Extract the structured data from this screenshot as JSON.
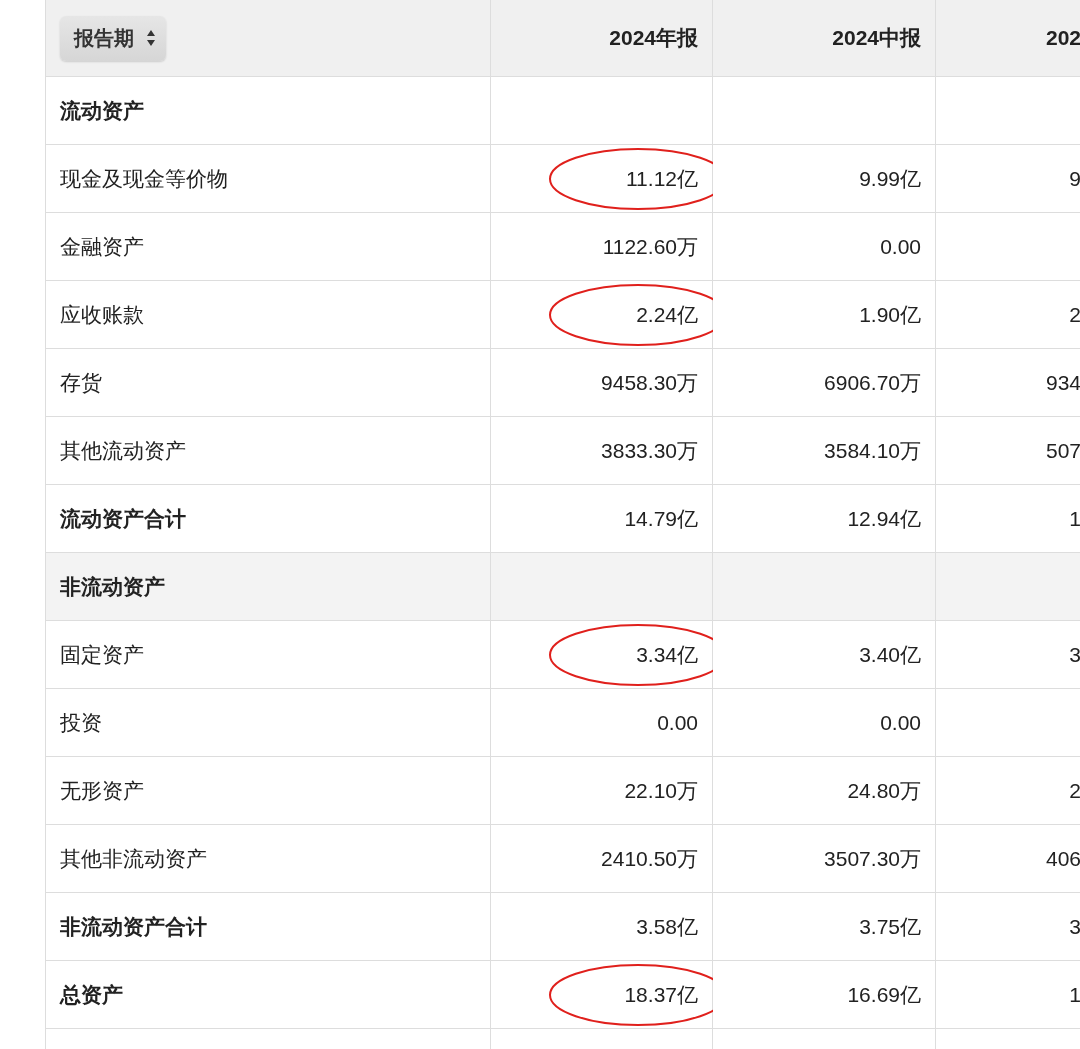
{
  "table": {
    "sort_button": {
      "label": "报告期"
    },
    "columns": [
      "2024年报",
      "2024中报",
      "202"
    ],
    "rows": [
      {
        "kind": "section",
        "label": "流动资产",
        "shaded": false,
        "circled": false
      },
      {
        "kind": "item",
        "label": "现金及现金等价物",
        "values": {
          "col_1": "11.12亿",
          "col_2": "9.99亿",
          "col_3": "9"
        },
        "circled": true
      },
      {
        "kind": "item",
        "label": "金融资产",
        "values": {
          "col_1": "1122.60万",
          "col_2": "0.00"
        },
        "circled": false
      },
      {
        "kind": "item",
        "label": "应收账款",
        "values": {
          "col_1": "2.24亿",
          "col_2": "1.90亿",
          "col_3": "2"
        },
        "circled": true
      },
      {
        "kind": "item",
        "label": "存货",
        "values": {
          "col_1": "9458.30万",
          "col_2": "6906.70万",
          "col_3": "934"
        },
        "circled": false
      },
      {
        "kind": "item",
        "label": "其他流动资产",
        "values": {
          "col_1": "3833.30万",
          "col_2": "3584.10万",
          "col_3": "507"
        },
        "circled": false
      },
      {
        "kind": "total",
        "label": "流动资产合计",
        "values": {
          "col_1": "14.79亿",
          "col_2": "12.94亿",
          "col_3": "1"
        },
        "circled": false
      },
      {
        "kind": "section",
        "label": "非流动资产",
        "shaded": true,
        "circled": false
      },
      {
        "kind": "item",
        "label": "固定资产",
        "values": {
          "col_1": "3.34亿",
          "col_2": "3.40亿",
          "col_3": "3"
        },
        "circled": true
      },
      {
        "kind": "item",
        "label": "投资",
        "values": {
          "col_1": "0.00",
          "col_2": "0.00"
        },
        "circled": false
      },
      {
        "kind": "item",
        "label": "无形资产",
        "values": {
          "col_1": "22.10万",
          "col_2": "24.80万",
          "col_3": "2"
        },
        "circled": false
      },
      {
        "kind": "item",
        "label": "其他非流动资产",
        "values": {
          "col_1": "2410.50万",
          "col_2": "3507.30万",
          "col_3": "406"
        },
        "circled": false
      },
      {
        "kind": "total",
        "label": "非流动资产合计",
        "values": {
          "col_1": "3.58亿",
          "col_2": "3.75亿",
          "col_3": "3"
        },
        "circled": false
      },
      {
        "kind": "total",
        "label": "总资产",
        "values": {
          "col_1": "18.37亿",
          "col_2": "16.69亿",
          "col_3": "1"
        },
        "circled": true
      }
    ]
  }
}
